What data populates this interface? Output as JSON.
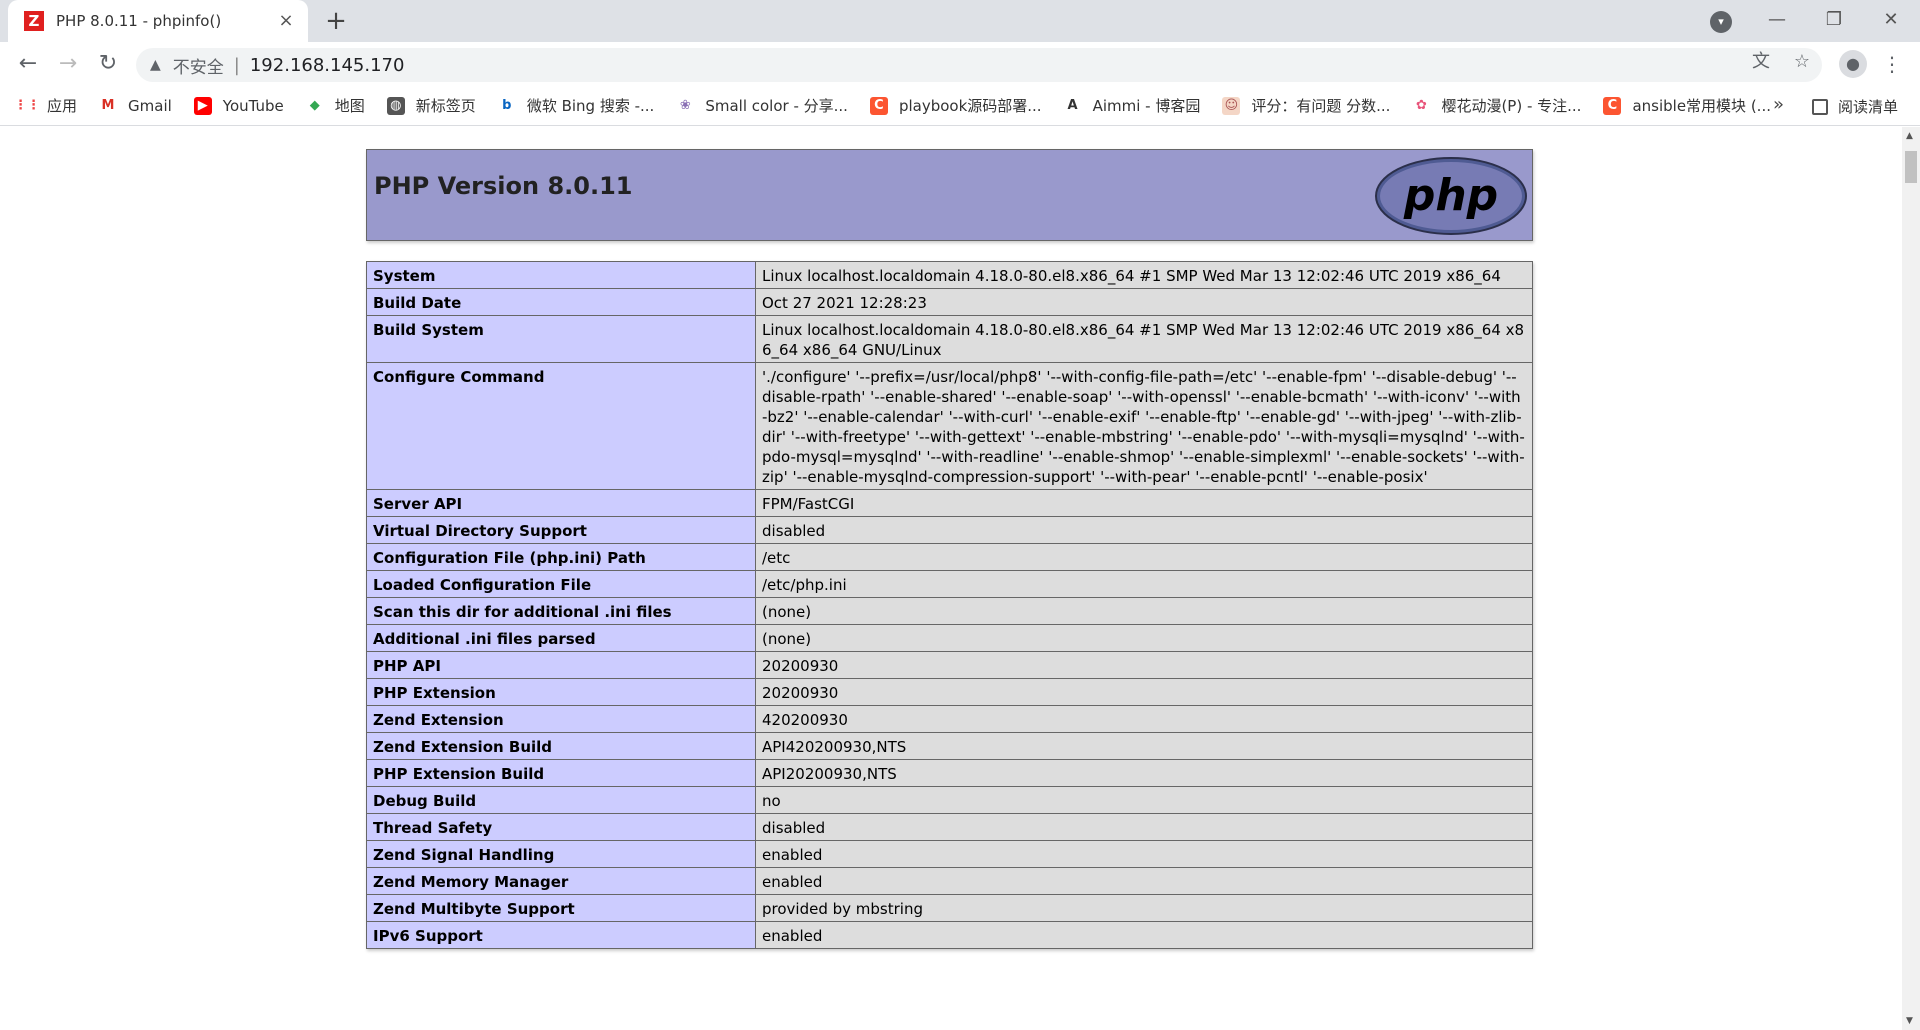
{
  "browser": {
    "tab_title": "PHP 8.0.11 - phpinfo()",
    "tab_favicon": "Z",
    "tab_close": "×",
    "new_tab": "+",
    "security_label": "不安全",
    "url": "192.168.145.170",
    "bookmarks": [
      {
        "label": "应用",
        "icon": "apps-grid-icon"
      },
      {
        "label": "Gmail",
        "icon": "gmail-icon"
      },
      {
        "label": "YouTube",
        "icon": "youtube-icon"
      },
      {
        "label": "地图",
        "icon": "maps-icon"
      },
      {
        "label": "新标签页",
        "icon": "globe-icon"
      },
      {
        "label": "微软 Bing 搜索 -...",
        "icon": "bing-icon"
      },
      {
        "label": "Small color - 分享...",
        "icon": "small-color-icon"
      },
      {
        "label": "playbook源码部署...",
        "icon": "csdn-icon"
      },
      {
        "label": "Aimmi - 博客园",
        "icon": "cnblogs-icon"
      },
      {
        "label": "评分：有问题 分数...",
        "icon": "avatar-icon"
      },
      {
        "label": "樱花动漫(P) - 专注...",
        "icon": "flower-icon"
      },
      {
        "label": "ansible常用模块 (...",
        "icon": "csdn-icon"
      }
    ],
    "more_bookmarks": "»",
    "reading_list": "阅读清单"
  },
  "page": {
    "title": "PHP Version 8.0.11",
    "logo_text": "php",
    "rows": [
      {
        "key": "System",
        "value": "Linux localhost.localdomain 4.18.0-80.el8.x86_64 #1 SMP Wed Mar 13 12:02:46 UTC 2019 x86_64"
      },
      {
        "key": "Build Date",
        "value": "Oct 27 2021 12:28:23"
      },
      {
        "key": "Build System",
        "value": "Linux localhost.localdomain 4.18.0-80.el8.x86_64 #1 SMP Wed Mar 13 12:02:46 UTC 2019 x86_64 x86_64 x86_64 GNU/Linux"
      },
      {
        "key": "Configure Command",
        "value": "'./configure' '--prefix=/usr/local/php8' '--with-config-file-path=/etc' '--enable-fpm' '--disable-debug' '--disable-rpath' '--enable-shared' '--enable-soap' '--with-openssl' '--enable-bcmath' '--with-iconv' '--with-bz2' '--enable-calendar' '--with-curl' '--enable-exif' '--enable-ftp' '--enable-gd' '--with-jpeg' '--with-zlib-dir' '--with-freetype' '--with-gettext' '--enable-mbstring' '--enable-pdo' '--with-mysqli=mysqlnd' '--with-pdo-mysql=mysqlnd' '--with-readline' '--enable-shmop' '--enable-simplexml' '--enable-sockets' '--with-zip' '--enable-mysqlnd-compression-support' '--with-pear' '--enable-pcntl' '--enable-posix'"
      },
      {
        "key": "Server API",
        "value": "FPM/FastCGI"
      },
      {
        "key": "Virtual Directory Support",
        "value": "disabled"
      },
      {
        "key": "Configuration File (php.ini) Path",
        "value": "/etc"
      },
      {
        "key": "Loaded Configuration File",
        "value": "/etc/php.ini"
      },
      {
        "key": "Scan this dir for additional .ini files",
        "value": "(none)"
      },
      {
        "key": "Additional .ini files parsed",
        "value": "(none)"
      },
      {
        "key": "PHP API",
        "value": "20200930"
      },
      {
        "key": "PHP Extension",
        "value": "20200930"
      },
      {
        "key": "Zend Extension",
        "value": "420200930"
      },
      {
        "key": "Zend Extension Build",
        "value": "API420200930,NTS"
      },
      {
        "key": "PHP Extension Build",
        "value": "API20200930,NTS"
      },
      {
        "key": "Debug Build",
        "value": "no"
      },
      {
        "key": "Thread Safety",
        "value": "disabled"
      },
      {
        "key": "Zend Signal Handling",
        "value": "enabled"
      },
      {
        "key": "Zend Memory Manager",
        "value": "enabled"
      },
      {
        "key": "Zend Multibyte Support",
        "value": "provided by mbstring"
      },
      {
        "key": "IPv6 Support",
        "value": "enabled"
      }
    ]
  }
}
